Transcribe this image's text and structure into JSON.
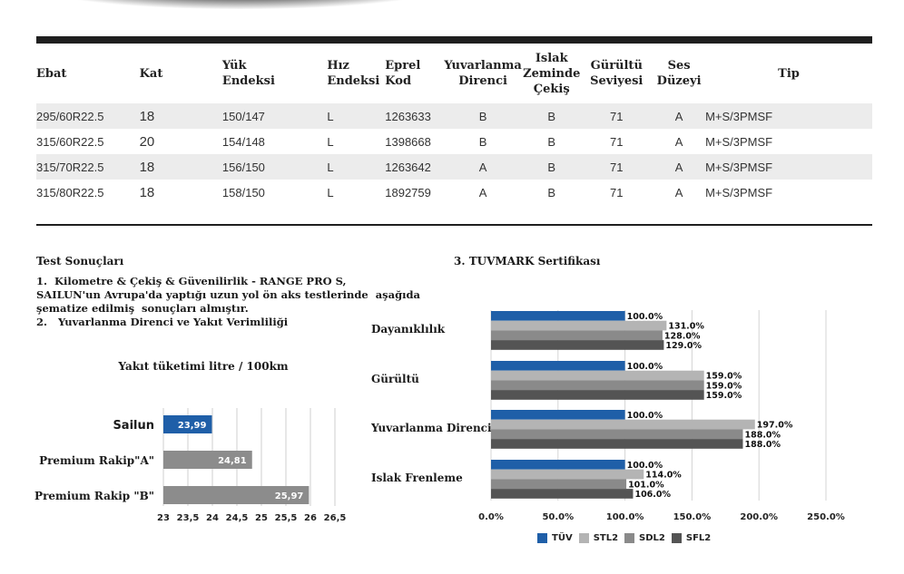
{
  "table": {
    "headers": [
      {
        "key": "ebat",
        "lines": [
          "Ebat"
        ]
      },
      {
        "key": "kat",
        "lines": [
          "Kat"
        ]
      },
      {
        "key": "yuk",
        "lines": [
          "Yük",
          "Endeksi"
        ]
      },
      {
        "key": "hiz",
        "lines": [
          "Hız",
          "Endeksi"
        ]
      },
      {
        "key": "eprel",
        "lines": [
          "Eprel",
          "Kod"
        ]
      },
      {
        "key": "yuv",
        "lines": [
          "Yuvarlanma",
          "Direnci"
        ]
      },
      {
        "key": "islak",
        "lines": [
          "Islak",
          "Zeminde",
          "Çekiş"
        ]
      },
      {
        "key": "gur",
        "lines": [
          "Gürültü",
          "Seviyesi"
        ]
      },
      {
        "key": "ses",
        "lines": [
          "Ses",
          "Düzeyi"
        ]
      },
      {
        "key": "tip",
        "lines": [
          "Tip"
        ]
      }
    ],
    "rows": [
      [
        "295/60R22.5",
        "18",
        "150/147",
        "L",
        "1263633",
        "B",
        "B",
        "71",
        "A",
        "M+S/3PMSF"
      ],
      [
        "315/60R22.5",
        "20",
        "154/148",
        "L",
        "1398668",
        "B",
        "B",
        "71",
        "A",
        "M+S/3PMSF"
      ],
      [
        "315/70R22.5",
        "18",
        "156/150",
        "L",
        "1263642",
        "A",
        "B",
        "71",
        "A",
        "M+S/3PMSF"
      ],
      [
        "315/80R22.5",
        "18",
        "158/150",
        "L",
        "1892759",
        "A",
        "B",
        "71",
        "A",
        "M+S/3PMSF"
      ]
    ]
  },
  "section": {
    "test_title": "Test Sonuçları",
    "paragraph": "1.  Kilometre & Çekiş & Güvenilirlik - RANGE PRO S,\nSAILUN'un Avrupa'da yaptığı uzun yol ön aks testlerinde  aşağıda\nşematize edilmiş  sonuçları almıştır.\n2.   Yuvarlanma Direnci ve Yakıt Verimliliği",
    "tuvmark_title": "3. TUVMARK Sertifikası"
  },
  "chart_data": [
    {
      "type": "bar",
      "orientation": "horizontal",
      "title": "Yakıt tüketimi litre / 100km",
      "categories": [
        "Sailun",
        "Premium Rakip\"A\"",
        "Premium Rakip \"B\""
      ],
      "values": [
        23.99,
        24.81,
        25.97
      ],
      "value_labels": [
        "23,99",
        "24,81",
        "25,97"
      ],
      "xlim": [
        23,
        26.5
      ],
      "xticks": [
        "23",
        "23,5",
        "24",
        "24,5",
        "25",
        "25,5",
        "26",
        "26,5"
      ],
      "colors": [
        "#1f5fa8",
        "#8c8c8c",
        "#8c8c8c"
      ],
      "grid": true
    },
    {
      "type": "bar",
      "orientation": "horizontal",
      "categories": [
        "Dayanıklılık",
        "Gürültü",
        "Yuvarlanma Direnci",
        "Islak Frenleme"
      ],
      "series": [
        {
          "name": "TÜV",
          "color": "#1f5fa8",
          "values": [
            100.0,
            100.0,
            100.0,
            100.0
          ]
        },
        {
          "name": "STL2",
          "color": "#b4b4b4",
          "values": [
            131.0,
            159.0,
            197.0,
            114.0
          ]
        },
        {
          "name": "SDL2",
          "color": "#8a8a8a",
          "values": [
            128.0,
            159.0,
            188.0,
            101.0
          ]
        },
        {
          "name": "SFL2",
          "color": "#545454",
          "values": [
            129.0,
            159.0,
            188.0,
            106.0
          ]
        }
      ],
      "xlim": [
        0,
        250
      ],
      "xticks": [
        "0.0%",
        "50.0%",
        "100.0%",
        "150.0%",
        "200.0%",
        "250.0%"
      ],
      "legend": "bottom",
      "grid": true
    }
  ]
}
